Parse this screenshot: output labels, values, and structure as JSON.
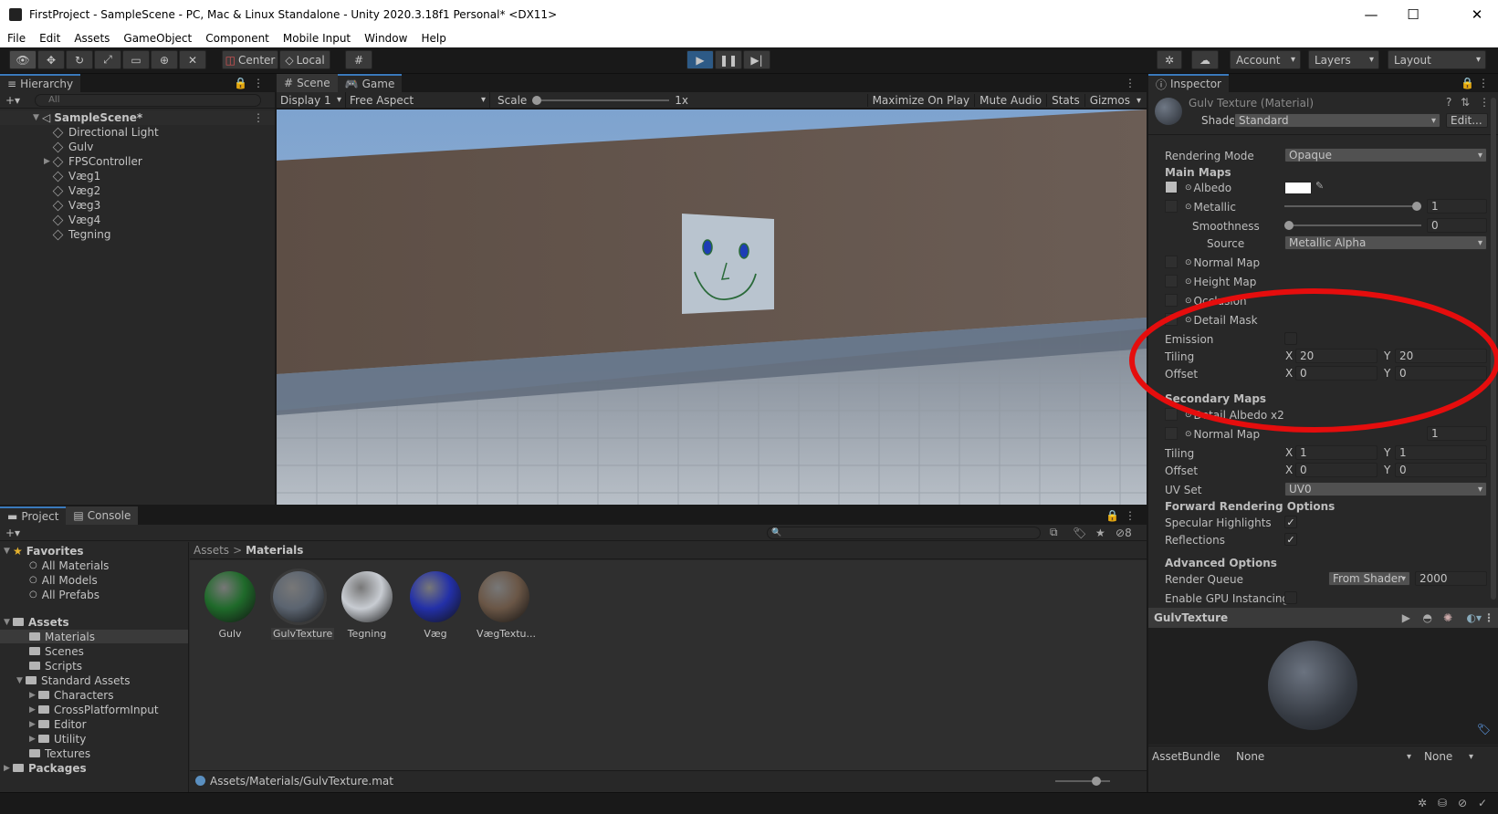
{
  "window": {
    "title": "FirstProject - SampleScene - PC, Mac & Linux Standalone - Unity 2020.3.18f1 Personal* <DX11>",
    "minimize": "—",
    "maximize": "☐",
    "close": "✕"
  },
  "menu": [
    "File",
    "Edit",
    "Assets",
    "GameObject",
    "Component",
    "Mobile Input",
    "Window",
    "Help"
  ],
  "toolbar": {
    "center_label": "Center",
    "local_label": "Local",
    "account_label": "Account",
    "layers_label": "Layers",
    "layout_label": "Layout"
  },
  "hierarchy": {
    "tab": "Hierarchy",
    "search_placeholder": "All",
    "scene": "SampleScene*",
    "items": [
      {
        "label": "Directional Light",
        "expandable": false
      },
      {
        "label": "Gulv",
        "expandable": false
      },
      {
        "label": "FPSController",
        "expandable": true
      },
      {
        "label": "Væg1",
        "expandable": false
      },
      {
        "label": "Væg2",
        "expandable": false
      },
      {
        "label": "Væg3",
        "expandable": false
      },
      {
        "label": "Væg4",
        "expandable": false
      },
      {
        "label": "Tegning",
        "expandable": false
      }
    ]
  },
  "game": {
    "tab_scene": "Scene",
    "tab_game": "Game",
    "display": "Display 1",
    "aspect": "Free Aspect",
    "scale_label": "Scale",
    "scale_value": "1x",
    "maximize": "Maximize On Play",
    "mute": "Mute Audio",
    "stats": "Stats",
    "gizmos": "Gizmos"
  },
  "inspector": {
    "tab": "Inspector",
    "title": "Gulv Texture (Material)",
    "shader_label": "Shader",
    "shader_value": "Standard",
    "edit_label": "Edit...",
    "rendering_mode_label": "Rendering Mode",
    "rendering_mode_value": "Opaque",
    "main_maps": "Main Maps",
    "albedo": "Albedo",
    "metallic": "Metallic",
    "metallic_value": "1",
    "metallic_fraction": 1.0,
    "smoothness": "Smoothness",
    "smoothness_value": "0",
    "smoothness_fraction": 0.0,
    "source_label": "Source",
    "source_value": "Metallic Alpha",
    "normal_map": "Normal Map",
    "height_map": "Height Map",
    "occlusion": "Occlusion",
    "detail_mask": "Detail Mask",
    "emission": "Emission",
    "tiling": "Tiling",
    "offset": "Offset",
    "x": "X",
    "y": "Y",
    "main_tiling_x": "20",
    "main_tiling_y": "20",
    "main_offset_x": "0",
    "main_offset_y": "0",
    "secondary_maps": "Secondary Maps",
    "detail_albedo": "Detail Albedo x2",
    "sec_normal_map": "Normal Map",
    "sec_normal_value": "1",
    "sec_tiling_x": "1",
    "sec_tiling_y": "1",
    "sec_offset_x": "0",
    "sec_offset_y": "0",
    "uv_set_label": "UV Set",
    "uv_set_value": "UV0",
    "forward_options": "Forward Rendering Options",
    "specular": "Specular Highlights",
    "specular_check": "✓",
    "reflections": "Reflections",
    "reflections_check": "✓",
    "advanced": "Advanced Options",
    "render_queue": "Render Queue",
    "render_queue_mode": "From Shader",
    "render_queue_value": "2000",
    "gpu_instancing": "Enable GPU Instancing",
    "preview_title": "GulvTexture",
    "assetbundle_label": "AssetBundle",
    "assetbundle_value": "None",
    "assetbundle_variant": "None"
  },
  "project": {
    "tab_project": "Project",
    "tab_console": "Console",
    "hidden_count": "8",
    "favorites": "Favorites",
    "fav_items": [
      "All Materials",
      "All Models",
      "All Prefabs"
    ],
    "assets": "Assets",
    "folders": [
      {
        "label": "Materials",
        "depth": 1,
        "expandable": false,
        "selected": true
      },
      {
        "label": "Scenes",
        "depth": 1,
        "expandable": false,
        "selected": false
      },
      {
        "label": "Scripts",
        "depth": 1,
        "expandable": false,
        "selected": false
      },
      {
        "label": "Standard Assets",
        "depth": 1,
        "expandable": true,
        "expanded": true,
        "selected": false
      },
      {
        "label": "Characters",
        "depth": 2,
        "expandable": true,
        "selected": false
      },
      {
        "label": "CrossPlatformInput",
        "depth": 2,
        "expandable": true,
        "selected": false
      },
      {
        "label": "Editor",
        "depth": 2,
        "expandable": true,
        "selected": false
      },
      {
        "label": "Utility",
        "depth": 2,
        "expandable": true,
        "selected": false
      },
      {
        "label": "Textures",
        "depth": 1,
        "expandable": false,
        "selected": false
      }
    ],
    "packages": "Packages",
    "breadcrumb_root": "Assets",
    "breadcrumb_sep": ">",
    "breadcrumb_current": "Materials",
    "materials": [
      {
        "label": "Gulv",
        "color": "#1f6a2a"
      },
      {
        "label": "GulvTexture",
        "color": "#5b6470"
      },
      {
        "label": "Tegning",
        "color": "#c8ccd2"
      },
      {
        "label": "Væg",
        "color": "#2330a8"
      },
      {
        "label": "VægTextu...",
        "color": "#6a5646"
      }
    ],
    "path": "Assets/Materials/GulvTexture.mat"
  }
}
